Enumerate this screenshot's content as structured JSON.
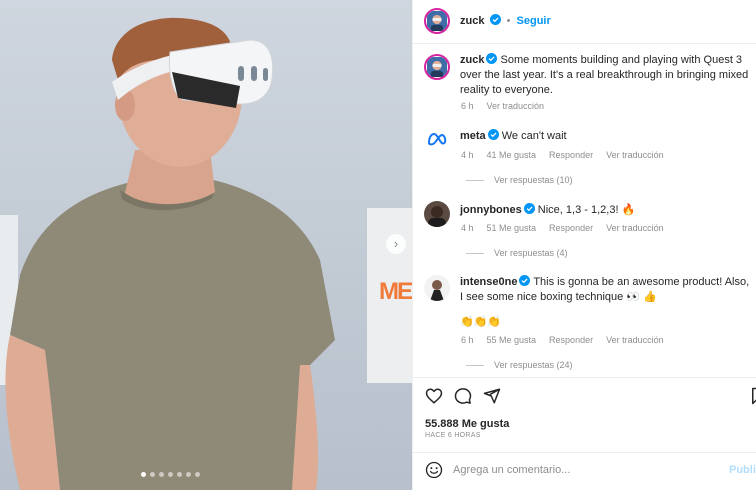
{
  "post": {
    "author": "zuck",
    "follow_label": "Seguir",
    "separator": "•",
    "caption_author": "zuck",
    "caption_text": "Some moments building and playing with Quest 3 over the last year. It's a real breakthrough in bringing mixed reality to everyone.",
    "caption_age": "6 h",
    "caption_translate": "Ver traducción",
    "next_icon": "chevron-right-icon",
    "carousel_total": 7,
    "carousel_active": 1
  },
  "comments": [
    {
      "username": "meta",
      "text": "We can't wait",
      "age": "4 h",
      "likes": "41 Me gusta",
      "reply": "Responder",
      "translate": "Ver traducción",
      "replies": "Ver respuestas (10)"
    },
    {
      "username": "jonnybones",
      "text": "Nice, 1,3 - 1,2,3! 🔥",
      "age": "4 h",
      "likes": "51 Me gusta",
      "reply": "Responder",
      "translate": "Ver traducción",
      "replies": "Ver respuestas (4)"
    },
    {
      "username": "intense0ne",
      "text": "This is gonna be an awesome product! Also, I see some nice boxing technique 👀 👍",
      "text2": "👏👏👏",
      "age": "6 h",
      "likes": "55 Me gusta",
      "reply": "Responder",
      "translate": "Ver traducción",
      "replies": "Ver respuestas (24)"
    }
  ],
  "actions": {
    "icons": [
      "heart-icon",
      "comment-icon",
      "share-icon",
      "bookmark-icon"
    ],
    "likes": "55.888 Me gusta",
    "time_ago": "HACE 6 HORAS"
  },
  "composer": {
    "placeholder": "Agrega un comentario...",
    "value": "",
    "post_label": "Publicar",
    "emoji_icon": "smiley-icon"
  },
  "colors": {
    "accent": "#0095f6",
    "verified": "#0095f6",
    "muted": "#8e8e8e",
    "text": "#262626",
    "story_ring": "#d6249f"
  }
}
